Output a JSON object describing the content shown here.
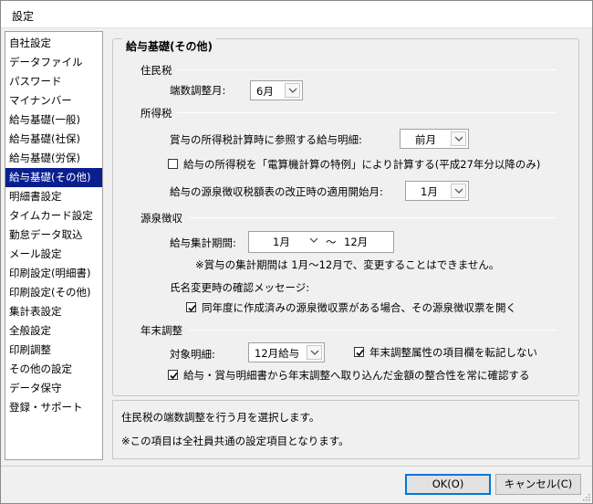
{
  "window": {
    "title": "設定"
  },
  "sidebar": {
    "items": [
      {
        "label": "自社設定",
        "selected": false
      },
      {
        "label": "データファイル",
        "selected": false
      },
      {
        "label": "パスワード",
        "selected": false
      },
      {
        "label": "マイナンバー",
        "selected": false
      },
      {
        "label": "給与基礎(一般)",
        "selected": false
      },
      {
        "label": "給与基礎(社保)",
        "selected": false
      },
      {
        "label": "給与基礎(労保)",
        "selected": false
      },
      {
        "label": "給与基礎(その他)",
        "selected": true
      },
      {
        "label": "明細書設定",
        "selected": false
      },
      {
        "label": "タイムカード設定",
        "selected": false
      },
      {
        "label": "勤怠データ取込",
        "selected": false
      },
      {
        "label": "メール設定",
        "selected": false
      },
      {
        "label": "印刷設定(明細書)",
        "selected": false
      },
      {
        "label": "印刷設定(その他)",
        "selected": false
      },
      {
        "label": "集計表設定",
        "selected": false
      },
      {
        "label": "全般設定",
        "selected": false
      },
      {
        "label": "印刷調整",
        "selected": false
      },
      {
        "label": "その他の設定",
        "selected": false
      },
      {
        "label": "データ保守",
        "selected": false
      },
      {
        "label": "登録・サポート",
        "selected": false
      }
    ],
    "selected_color": "#0a1f8f"
  },
  "main": {
    "group_title": "給与基礎(その他)",
    "resident_tax": {
      "heading": "住民税",
      "rounding_month_label": "端数調整月:",
      "rounding_month_value": "6月"
    },
    "income_tax": {
      "heading": "所得税",
      "bonus_ref_label": "賞与の所得税計算時に参照する給与明細:",
      "bonus_ref_value": "前月",
      "special_calc_label": "給与の所得税を「電算機計算の特例」により計算する(平成27年分以降のみ)",
      "special_calc_checked": false,
      "revision_start_label": "給与の源泉徴収税額表の改正時の適用開始月:",
      "revision_start_value": "1月"
    },
    "withholding": {
      "heading": "源泉徴収",
      "period_label": "給与集計期間:",
      "period_from": "1月",
      "period_tilde": "～",
      "period_to": "12月",
      "bonus_note": "※賞与の集計期間は 1月～12月で、変更することはできません。",
      "name_change_label": "氏名変更時の確認メッセージ:",
      "name_change_check_label": "同年度に作成済みの源泉徴収票がある場合、その源泉徴収票を開く",
      "name_change_checked": true
    },
    "year_end": {
      "heading": "年末調整",
      "target_label": "対象明細:",
      "target_value": "12月給与",
      "no_copy_label": "年末調整属性の項目欄を転記しない",
      "no_copy_checked": true,
      "consistency_label": "給与・賞与明細書から年末調整へ取り込んだ金額の整合性を常に確認する",
      "consistency_checked": true
    }
  },
  "info": {
    "line1": "住民税の端数調整を行う月を選択します。",
    "line2": "※この項目は全社員共通の設定項目となります。"
  },
  "buttons": {
    "ok_label": "OK(O)",
    "cancel_label": "キャンセル(C)"
  }
}
